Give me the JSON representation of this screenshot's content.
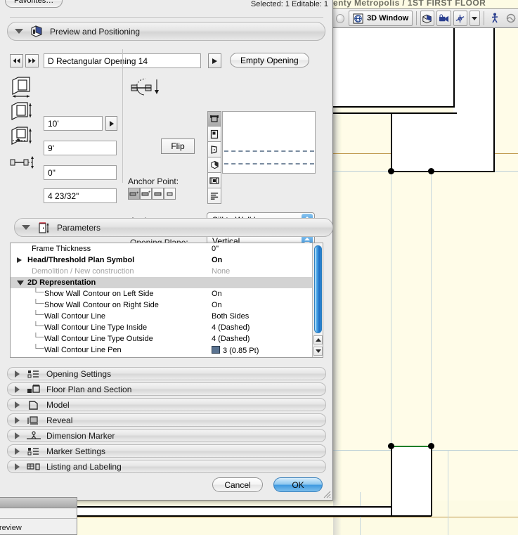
{
  "cad": {
    "title": "enty Metropolis / 1ST FIRST FLOOR",
    "toolbar": {
      "window_label": "3D Window",
      "icons": [
        {
          "name": "3d-globe-icon",
          "glyph": "⬟"
        },
        {
          "name": "axonometry-icon",
          "glyph": "◧"
        },
        {
          "name": "camera-icon",
          "glyph": "◗"
        },
        {
          "name": "axis-orbit-icon",
          "glyph": "✲"
        },
        {
          "name": "dropdown-arrow-icon",
          "glyph": "▼"
        },
        {
          "name": "walk-figure-icon",
          "glyph": "Ὣ6"
        },
        {
          "name": "sun-settings-icon",
          "glyph": "☀"
        }
      ]
    }
  },
  "dialog": {
    "favorites_label": "Favorites…",
    "selection_status": "Selected: 1 Editable: 1",
    "preview_section": {
      "title": "Preview and Positioning",
      "icon": "object-preview-icon",
      "nav_prev": "◀◀",
      "nav_next": "▶▶",
      "object_name": "D Rectangular Opening 14",
      "popup_arrow": "▶",
      "type_button": "Empty Opening",
      "fields": [
        {
          "icon": "opening-width-icon",
          "value": "10'",
          "has_stepper": true
        },
        {
          "icon": "opening-height-icon",
          "value": "9'",
          "has_stepper": false
        },
        {
          "icon": "sill-height-icon",
          "value": "0\"",
          "has_stepper": false
        },
        {
          "icon": "wall-thickness-icon",
          "value": "4 23/32\"",
          "has_stepper": false
        }
      ],
      "flip_button": "Flip",
      "flip_icon": "mirror-flip-icon",
      "anchor_point_label": "Anchor Point:",
      "anchor_cells": [
        {
          "name": "anchor-cell-1",
          "selected": true
        },
        {
          "name": "anchor-cell-2",
          "selected": false
        },
        {
          "name": "anchor-cell-3",
          "selected": false
        },
        {
          "name": "anchor-cell-4",
          "selected": false
        }
      ],
      "anchor_label": "Anchor:",
      "anchor_value": "Sill to Wall base",
      "opening_plane_label": "Opening Plane:",
      "opening_plane_value": "Vertical",
      "preview_tools": [
        {
          "name": "preview-tool-elevation",
          "glyph": "⬒",
          "active": true
        },
        {
          "name": "preview-tool-plan",
          "glyph": "▣",
          "active": false
        },
        {
          "name": "preview-tool-door-swing",
          "glyph": "◢",
          "active": false
        },
        {
          "name": "preview-tool-3d",
          "glyph": "⬟",
          "active": false
        },
        {
          "name": "preview-tool-section",
          "glyph": "▥",
          "active": false
        },
        {
          "name": "preview-tool-list",
          "glyph": "☰",
          "active": false
        }
      ]
    },
    "parameters_section": {
      "title": "Parameters",
      "icon": "parameters-icon",
      "rows": [
        {
          "name": "Frame Thickness",
          "value": "0\"",
          "indent": 1,
          "twisty": "none",
          "style": "normal",
          "elbow": false
        },
        {
          "name": "Head/Threshold Plan Symbol",
          "value": "On",
          "indent": 0,
          "twisty": "right",
          "style": "bold",
          "elbow": false
        },
        {
          "name": "Demolition / New construction",
          "value": "None",
          "indent": 1,
          "twisty": "none",
          "style": "dim",
          "elbow": false
        },
        {
          "name": "2D Representation",
          "value": "",
          "indent": 0,
          "twisty": "down",
          "style": "bold-hl",
          "elbow": false
        },
        {
          "name": "Show Wall Contour on Left Side",
          "value": "On",
          "indent": 2,
          "twisty": "none",
          "style": "normal",
          "elbow": true
        },
        {
          "name": "Show Wall Contour on Right Side",
          "value": "On",
          "indent": 2,
          "twisty": "none",
          "style": "normal",
          "elbow": true
        },
        {
          "name": "Wall Contour Line",
          "value": "Both Sides",
          "indent": 2,
          "twisty": "none",
          "style": "normal",
          "elbow": true
        },
        {
          "name": "Wall Contour Line Type Inside",
          "value": "4 (Dashed)",
          "indent": 2,
          "twisty": "none",
          "style": "normal",
          "elbow": true
        },
        {
          "name": "Wall Contour Line Type Outside",
          "value": "4 (Dashed)",
          "indent": 2,
          "twisty": "none",
          "style": "normal",
          "elbow": true
        },
        {
          "name": "Wall Contour Line Pen",
          "value": "3 (0.85 Pt)",
          "indent": 2,
          "twisty": "none",
          "style": "swatch",
          "elbow": true,
          "swatch_color": "#5a7391"
        }
      ],
      "scroll_up_arrow": "▲",
      "scroll_down_arrow": "▼"
    },
    "collapsed_sections": [
      {
        "label": "Opening Settings",
        "icon": "opening-settings-icon",
        "glyph": "☷"
      },
      {
        "label": "Floor Plan and Section",
        "icon": "floor-plan-section-icon",
        "glyph": "◩"
      },
      {
        "label": "Model",
        "icon": "model-icon",
        "glyph": "⬠"
      },
      {
        "label": "Reveal",
        "icon": "reveal-icon",
        "glyph": "◨"
      },
      {
        "label": "Dimension Marker",
        "icon": "dimension-marker-icon",
        "glyph": "↦"
      },
      {
        "label": "Marker Settings",
        "icon": "marker-settings-icon",
        "glyph": "☷"
      },
      {
        "label": "Listing and Labeling",
        "icon": "listing-labeling-icon",
        "glyph": "⌸"
      }
    ],
    "buttons": {
      "cancel": "Cancel",
      "ok": "OK"
    }
  },
  "background_window": {
    "label": "review"
  },
  "colors": {
    "paper": "#fdfbe4",
    "dialog_bg": "#ececec",
    "accent_blue": "#2d85d0",
    "ok_blue": "#3f9ae0",
    "pen_swatch": "#5a7391",
    "selection_green": "#1e7d28",
    "guide_blue": "#b9cdd6",
    "guide_orange": "#b4862f"
  }
}
